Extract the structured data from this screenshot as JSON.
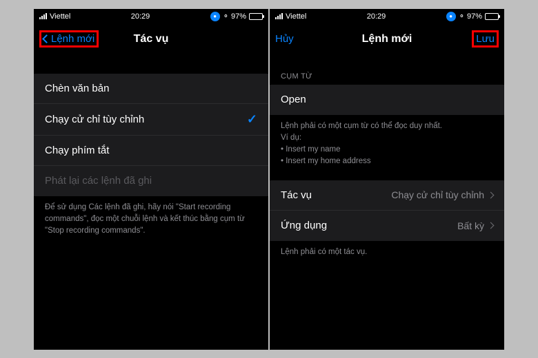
{
  "status": {
    "carrier": "Viettel",
    "time": "20:29",
    "battery_pct": "97%"
  },
  "left": {
    "back_label": "Lệnh mới",
    "title": "Tác vụ",
    "rows": {
      "insert_text": "Chèn văn bản",
      "custom_gesture": "Chạy cử chỉ tùy chỉnh",
      "shortcut": "Chạy phím tắt",
      "replay_recorded": "Phát lại các lệnh đã ghi"
    },
    "footer": "Để sử dụng Các lệnh đã ghi, hãy nói \"Start recording commands\", đọc một chuỗi lệnh và kết thúc bằng cụm từ \"Stop recording commands\"."
  },
  "right": {
    "cancel": "Hủy",
    "title": "Lệnh mới",
    "save": "Lưu",
    "phrase_header": "CỤM TỪ",
    "phrase_value": "Open",
    "phrase_footer_1": "Lệnh phải có một cụm từ có thể đọc duy nhất.",
    "phrase_footer_2": "Ví dụ:",
    "phrase_ex1": "Insert my name",
    "phrase_ex2": "Insert my home address",
    "action_label": "Tác vụ",
    "action_value": "Chạy cử chỉ tùy chỉnh",
    "app_label": "Ứng dụng",
    "app_value": "Bất kỳ",
    "bottom_footer": "Lệnh phải có một tác vụ."
  }
}
